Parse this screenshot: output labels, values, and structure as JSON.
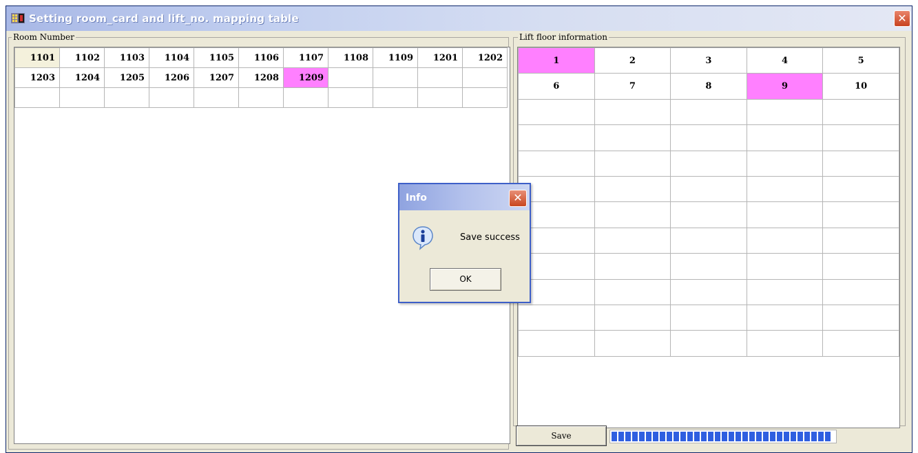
{
  "window": {
    "title": "Setting room_card and lift_no. mapping table",
    "close_label": "✕"
  },
  "room_panel": {
    "legend": "Room Number",
    "rows": [
      [
        "1101",
        "1102",
        "1103",
        "1104",
        "1105",
        "1106",
        "1107",
        "1108",
        "1109",
        "1201",
        "1202"
      ],
      [
        "1203",
        "1204",
        "1205",
        "1206",
        "1207",
        "1208",
        "1209",
        "",
        "",
        "",
        ""
      ],
      [
        "",
        "",
        "",
        "",
        "",
        "",
        "",
        "",
        "",
        "",
        ""
      ]
    ],
    "selected": "1209"
  },
  "lift_panel": {
    "legend": "Lift floor information",
    "rows": [
      [
        "1",
        "2",
        "3",
        "4",
        "5"
      ],
      [
        "6",
        "7",
        "8",
        "9",
        "10"
      ],
      [
        "",
        "",
        "",
        "",
        ""
      ],
      [
        "",
        "",
        "",
        "",
        ""
      ],
      [
        "",
        "",
        "",
        "",
        ""
      ],
      [
        "",
        "",
        "",
        "",
        ""
      ],
      [
        "",
        "",
        "",
        "",
        ""
      ],
      [
        "",
        "",
        "",
        "",
        ""
      ],
      [
        "",
        "",
        "",
        "",
        ""
      ],
      [
        "",
        "",
        "",
        "",
        ""
      ],
      [
        "",
        "",
        "",
        "",
        ""
      ],
      [
        "",
        "",
        "",
        "",
        ""
      ]
    ],
    "selected": [
      "1",
      "9"
    ]
  },
  "save_button": {
    "label": "Save"
  },
  "progress": {
    "fraction": 1.0
  },
  "dialog": {
    "title": "Info",
    "close_label": "✕",
    "message": "Save success",
    "ok_label": "OK",
    "icon": "info-icon"
  },
  "colors": {
    "selected_cell": "#ff80ff",
    "progress_block": "#2f5fe0",
    "window_bg": "#ece9d8"
  }
}
